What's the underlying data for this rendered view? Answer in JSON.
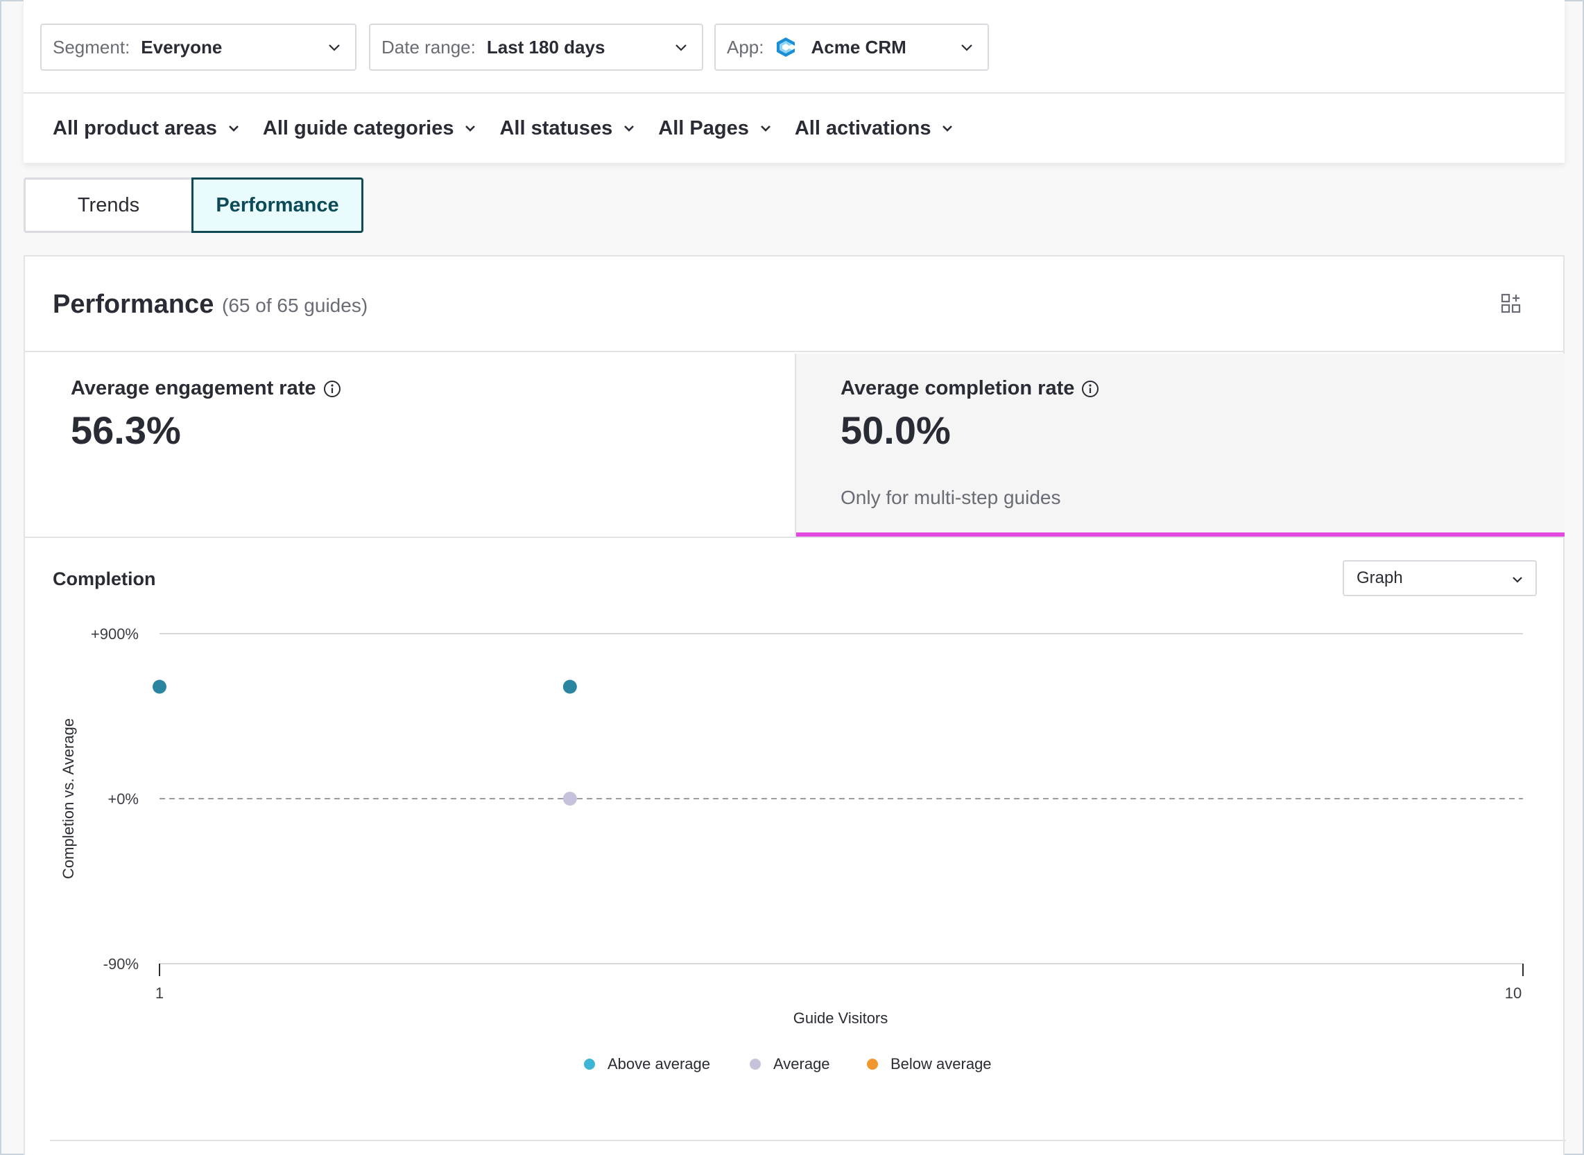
{
  "filters": {
    "segment": {
      "label": "Segment:",
      "value": "Everyone"
    },
    "date_range": {
      "label": "Date range:",
      "value": "Last 180 days"
    },
    "app": {
      "label": "App:",
      "value": "Acme CRM",
      "logo_icon": "acme-crm-logo"
    },
    "pills": [
      {
        "label": "All product areas"
      },
      {
        "label": "All guide categories"
      },
      {
        "label": "All statuses"
      },
      {
        "label": "All Pages"
      },
      {
        "label": "All activations"
      }
    ]
  },
  "tabs": [
    {
      "label": "Trends",
      "active": false
    },
    {
      "label": "Performance",
      "active": true
    }
  ],
  "card": {
    "title": "Performance",
    "count": "(65 of 65 guides)",
    "widget_icon": "add-widget-icon"
  },
  "metrics": {
    "engagement": {
      "label": "Average engagement rate",
      "value": "56.3%",
      "info_icon": "info-icon"
    },
    "completion": {
      "label": "Average completion rate",
      "value": "50.0%",
      "note": "Only for multi-step guides",
      "info_icon": "info-icon",
      "selected": true,
      "accent_color": "#e24adf"
    }
  },
  "chart_section": {
    "title": "Completion",
    "view_select": {
      "value": "Graph"
    }
  },
  "chart_data": {
    "type": "scatter",
    "title": "Completion",
    "xlabel": "Guide Visitors",
    "ylabel": "Completion vs. Average",
    "x_scale": "log",
    "xlim": [
      1,
      10
    ],
    "x_ticks": [
      {
        "value": 1,
        "label": "1"
      },
      {
        "value": 10,
        "label": "10"
      }
    ],
    "y_ticks": [
      {
        "value": 900,
        "label": "+900%"
      },
      {
        "value": 0,
        "label": "+0%"
      },
      {
        "value": -90,
        "label": "-90%"
      }
    ],
    "y_scale": "symlog",
    "ylim": [
      -90,
      900
    ],
    "reference_line": {
      "y": 0,
      "style": "dashed"
    },
    "series": [
      {
        "name": "Above average",
        "color": "#3fb5d6",
        "marker_color": "#2a86a0",
        "points": [
          {
            "x": 1,
            "y": 100
          },
          {
            "x": 2,
            "y": 100
          }
        ]
      },
      {
        "name": "Average",
        "color": "#c6c2dc",
        "marker_color": "#c6c2dc",
        "points": [
          {
            "x": 2,
            "y": 0
          }
        ]
      },
      {
        "name": "Below average",
        "color": "#f2962f",
        "marker_color": "#f2962f",
        "points": []
      }
    ],
    "legend_position": "bottom-center",
    "grid": true
  },
  "colors": {
    "active_tab_border": "#124a54",
    "active_tab_bg": "#e9fbfd",
    "completion_accent": "#e24adf"
  }
}
